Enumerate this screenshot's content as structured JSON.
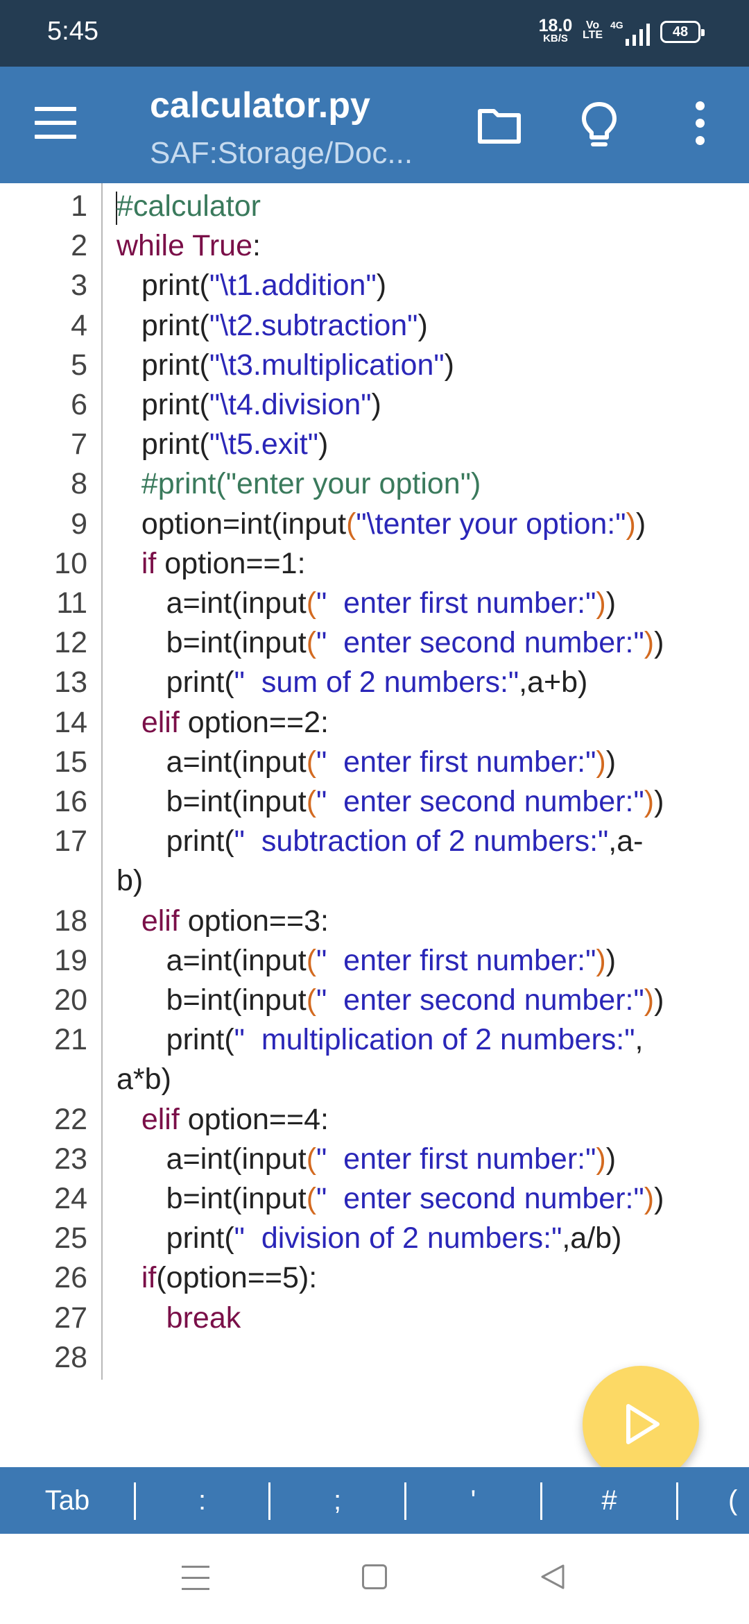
{
  "status_bar": {
    "time": "5:45",
    "net_speed": "18.0",
    "net_unit": "KB/S",
    "volte_top": "Vo",
    "volte_bottom": "LTE",
    "network": "4G",
    "battery": "48"
  },
  "app_bar": {
    "title": "calculator.py",
    "subtitle": "SAF:Storage/Doc...",
    "icons": [
      "menu-icon",
      "folder-icon",
      "lightbulb-icon",
      "more-vert-icon"
    ]
  },
  "editor": {
    "lines": [
      {
        "n": "1",
        "parts": [
          {
            "t": "#calculator",
            "c": "cm"
          }
        ]
      },
      {
        "n": "2",
        "parts": [
          {
            "t": "while True",
            "c": "kw"
          },
          {
            "t": ":",
            "c": ""
          }
        ]
      },
      {
        "n": "3",
        "parts": [
          {
            "t": "   print(",
            "c": ""
          },
          {
            "t": "\"\\t1.addition\"",
            "c": "str"
          },
          {
            "t": ")",
            "c": ""
          }
        ]
      },
      {
        "n": "4",
        "parts": [
          {
            "t": "   print(",
            "c": ""
          },
          {
            "t": "\"\\t2.subtraction\"",
            "c": "str"
          },
          {
            "t": ")",
            "c": ""
          }
        ]
      },
      {
        "n": "5",
        "parts": [
          {
            "t": "   print(",
            "c": ""
          },
          {
            "t": "\"\\t3.multiplication\"",
            "c": "str"
          },
          {
            "t": ")",
            "c": ""
          }
        ]
      },
      {
        "n": "6",
        "parts": [
          {
            "t": "   print(",
            "c": ""
          },
          {
            "t": "\"\\t4.division\"",
            "c": "str"
          },
          {
            "t": ")",
            "c": ""
          }
        ]
      },
      {
        "n": "7",
        "parts": [
          {
            "t": "   print(",
            "c": ""
          },
          {
            "t": "\"\\t5.exit\"",
            "c": "str"
          },
          {
            "t": ")",
            "c": ""
          }
        ]
      },
      {
        "n": "8",
        "parts": [
          {
            "t": "   #print(\"enter your option\")",
            "c": "cm"
          }
        ]
      },
      {
        "n": "9",
        "parts": [
          {
            "t": "   option=int(input",
            "c": ""
          },
          {
            "t": "(",
            "c": "par"
          },
          {
            "t": "\"\\tenter your option:\"",
            "c": "str"
          },
          {
            "t": ")",
            "c": "par"
          },
          {
            "t": ")",
            "c": ""
          }
        ]
      },
      {
        "n": "10",
        "parts": [
          {
            "t": "   if",
            "c": "kw"
          },
          {
            "t": " option==1:",
            "c": ""
          }
        ]
      },
      {
        "n": "11",
        "parts": [
          {
            "t": "      a=int(input",
            "c": ""
          },
          {
            "t": "(",
            "c": "par"
          },
          {
            "t": "\"  enter first number:\"",
            "c": "str"
          },
          {
            "t": ")",
            "c": "par"
          },
          {
            "t": ")",
            "c": ""
          }
        ]
      },
      {
        "n": "12",
        "parts": [
          {
            "t": "      b=int(input",
            "c": ""
          },
          {
            "t": "(",
            "c": "par"
          },
          {
            "t": "\"  enter second number:\"",
            "c": "str"
          },
          {
            "t": ")",
            "c": "par"
          },
          {
            "t": ")",
            "c": ""
          }
        ]
      },
      {
        "n": "13",
        "parts": [
          {
            "t": "      print(",
            "c": ""
          },
          {
            "t": "\"  sum of 2 numbers:\"",
            "c": "str"
          },
          {
            "t": ",a+b)",
            "c": ""
          }
        ]
      },
      {
        "n": "14",
        "parts": [
          {
            "t": "   elif",
            "c": "kw"
          },
          {
            "t": " option==2:",
            "c": ""
          }
        ]
      },
      {
        "n": "15",
        "parts": [
          {
            "t": "      a=int(input",
            "c": ""
          },
          {
            "t": "(",
            "c": "par"
          },
          {
            "t": "\"  enter first number:\"",
            "c": "str"
          },
          {
            "t": ")",
            "c": "par"
          },
          {
            "t": ")",
            "c": ""
          }
        ]
      },
      {
        "n": "16",
        "parts": [
          {
            "t": "      b=int(input",
            "c": ""
          },
          {
            "t": "(",
            "c": "par"
          },
          {
            "t": "\"  enter second number:\"",
            "c": "str"
          },
          {
            "t": ")",
            "c": "par"
          },
          {
            "t": ")",
            "c": ""
          }
        ]
      },
      {
        "n": "17",
        "parts": [
          {
            "t": "      print(",
            "c": ""
          },
          {
            "t": "\"  subtraction of 2 numbers:\"",
            "c": "str"
          },
          {
            "t": ",a-",
            "c": ""
          }
        ]
      },
      {
        "n": "",
        "parts": [
          {
            "t": "b)",
            "c": ""
          }
        ]
      },
      {
        "n": "18",
        "parts": [
          {
            "t": "   elif",
            "c": "kw"
          },
          {
            "t": " option==3:",
            "c": ""
          }
        ]
      },
      {
        "n": "19",
        "parts": [
          {
            "t": "      a=int(input",
            "c": ""
          },
          {
            "t": "(",
            "c": "par"
          },
          {
            "t": "\"  enter first number:\"",
            "c": "str"
          },
          {
            "t": ")",
            "c": "par"
          },
          {
            "t": ")",
            "c": ""
          }
        ]
      },
      {
        "n": "20",
        "parts": [
          {
            "t": "      b=int(input",
            "c": ""
          },
          {
            "t": "(",
            "c": "par"
          },
          {
            "t": "\"  enter second number:\"",
            "c": "str"
          },
          {
            "t": ")",
            "c": "par"
          },
          {
            "t": ")",
            "c": ""
          }
        ]
      },
      {
        "n": "21",
        "parts": [
          {
            "t": "      print(",
            "c": ""
          },
          {
            "t": "\"  multiplication of 2 numbers:\"",
            "c": "str"
          },
          {
            "t": ",",
            "c": ""
          }
        ]
      },
      {
        "n": "",
        "parts": [
          {
            "t": "a*b)",
            "c": ""
          }
        ]
      },
      {
        "n": "22",
        "parts": [
          {
            "t": "   elif",
            "c": "kw"
          },
          {
            "t": " option==4:",
            "c": ""
          }
        ]
      },
      {
        "n": "23",
        "parts": [
          {
            "t": "      a=int(input",
            "c": ""
          },
          {
            "t": "(",
            "c": "par"
          },
          {
            "t": "\"  enter first number:\"",
            "c": "str"
          },
          {
            "t": ")",
            "c": "par"
          },
          {
            "t": ")",
            "c": ""
          }
        ]
      },
      {
        "n": "24",
        "parts": [
          {
            "t": "      b=int(input",
            "c": ""
          },
          {
            "t": "(",
            "c": "par"
          },
          {
            "t": "\"  enter second number:\"",
            "c": "str"
          },
          {
            "t": ")",
            "c": "par"
          },
          {
            "t": ")",
            "c": ""
          }
        ]
      },
      {
        "n": "25",
        "parts": [
          {
            "t": "      print(",
            "c": ""
          },
          {
            "t": "\"  division of 2 numbers:\"",
            "c": "str"
          },
          {
            "t": ",a/b)",
            "c": ""
          }
        ]
      },
      {
        "n": "26",
        "parts": [
          {
            "t": "   if",
            "c": "kw"
          },
          {
            "t": "(option==5):",
            "c": ""
          }
        ]
      },
      {
        "n": "27",
        "parts": [
          {
            "t": "      break",
            "c": "kw"
          }
        ]
      },
      {
        "n": "28",
        "parts": []
      }
    ]
  },
  "run_button": {
    "icon": "play-icon"
  },
  "key_bar": {
    "keys": [
      "Tab",
      ":",
      ";",
      "'",
      "#",
      "("
    ]
  },
  "nav_bar": {
    "icons": [
      "recents-icon",
      "home-icon",
      "back-icon"
    ]
  },
  "colors": {
    "status_bar": "#243c52",
    "app_bar": "#3c78b3",
    "fab": "#fcd965",
    "comment": "#3a7a5c",
    "keyword": "#7a0f48",
    "string": "#2a26b8",
    "paren": "#d36a20"
  }
}
